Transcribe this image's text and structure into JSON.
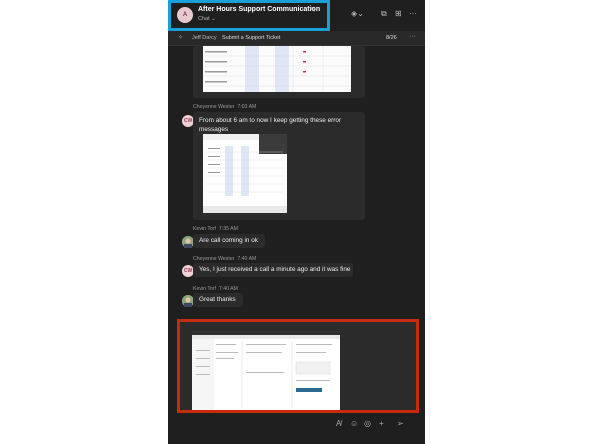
{
  "header": {
    "avatar_initials": "A",
    "title": "After Hours Support Communication",
    "subtitle": "Chat",
    "subtitle_chevron": "⌄",
    "icons": [
      "edit-icon",
      "diamond-icon",
      "share-screen-icon",
      "popout-icon",
      "more-icon"
    ]
  },
  "subbar": {
    "pinned_name": "Jeff Darcy",
    "pinned_text": "Submit a Support Ticket",
    "count": "8/26",
    "more": "···"
  },
  "messages": [
    {
      "sender": "Cheyenne Wester",
      "time": "7:03 AM",
      "initials": "CW",
      "text": "From about 6 am to now I keep getting these error messages"
    },
    {
      "sender": "Kevin Torf",
      "time": "7:35 AM",
      "initials": "KT",
      "text": "Are call coming in ok"
    },
    {
      "sender": "Cheyenne Wester",
      "time": "7:40 AM",
      "initials": "CW",
      "text": "Yes, I just received a call a minute ago and it was fine"
    },
    {
      "sender": "Kevin Torf",
      "time": "7:40 AM",
      "initials": "KT",
      "text": "Great thanks"
    }
  ],
  "colors": {
    "highlight_blue": "#1aa0d8",
    "highlight_red": "#c62b0b",
    "panel_bg": "#1f1f1f",
    "bubble_bg": "#2b2b2b"
  }
}
